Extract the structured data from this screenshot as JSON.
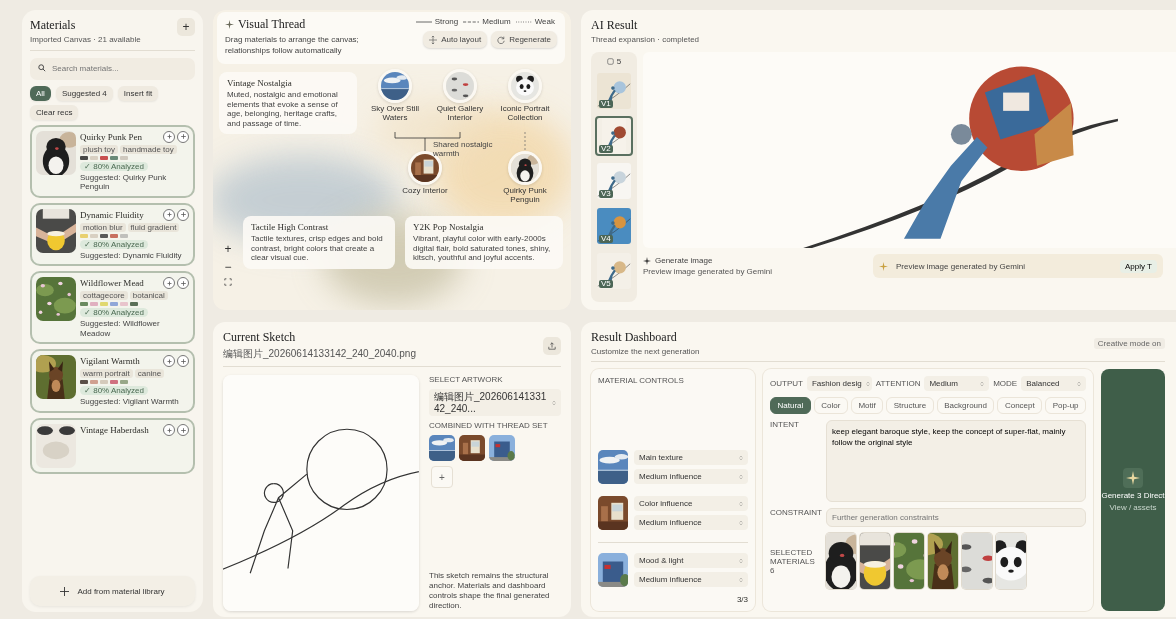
{
  "sidebar": {
    "title": "Materials",
    "subtitle": "Imported Canvas · 21 available",
    "add": "+",
    "search": {
      "placeholder": "Search materials..."
    },
    "filters": [
      {
        "label": "All",
        "selected": true
      },
      {
        "label": "Suggested 4",
        "selected": false
      },
      {
        "label": "Insert fit",
        "selected": false
      },
      {
        "label": "Clear recs",
        "selected": false
      }
    ],
    "materials": [
      {
        "title": "Quirky Punk Pen",
        "tags": [
          "plush toy",
          "handmade toy"
        ],
        "colors": [
          {
            "color": "#4a4a48"
          },
          {
            "color": "#d8d0c2"
          },
          {
            "color": "#c85050"
          },
          {
            "color": "#6a8a78"
          },
          {
            "color": "#cfc9be"
          }
        ],
        "badge": "✓ 80% Analyzed",
        "description": "Suggested: Quirky Punk Penguin"
      },
      {
        "title": "Dynamic Fluidity",
        "tags": [
          "motion blur",
          "fluid gradient"
        ],
        "colors": [
          {
            "color": "#e8d070"
          },
          {
            "color": "#d8d0c2"
          },
          {
            "color": "#5a5a58"
          },
          {
            "color": "#c87060"
          },
          {
            "color": "#c0c0bc"
          }
        ],
        "badge": "✓ 80% Analyzed",
        "description": "Suggested: Dynamic Fluidity"
      },
      {
        "title": "Wildflower Mead",
        "tags": [
          "cottagecore",
          "botanical"
        ],
        "colors": [
          {
            "color": "#6a8a60"
          },
          {
            "color": "#e0b0c0"
          },
          {
            "color": "#e0d870"
          },
          {
            "color": "#90a8d8"
          },
          {
            "color": "#e8c4cc"
          },
          {
            "color": "#5a7058"
          }
        ],
        "badge": "✓ 80% Analyzed",
        "description": "Suggested: Wildflower Meadow"
      },
      {
        "title": "Vigilant Warmth",
        "tags": [
          "warm portrait",
          "canine"
        ],
        "colors": [
          {
            "color": "#5a5048"
          },
          {
            "color": "#d0a090"
          },
          {
            "color": "#d4cabb"
          },
          {
            "color": "#d07080"
          },
          {
            "color": "#98a888"
          }
        ],
        "badge": "✓ 80% Analyzed",
        "description": "Suggested: Vigilant Warmth"
      },
      {
        "title": "Vintage Haberdash"
      }
    ],
    "add_button": "Add from material library"
  },
  "visual_thread": {
    "title": "Visual Thread",
    "description": "Drag materials to arrange the canvas; relationships follow automatically",
    "legend": [
      {
        "label": "Strong",
        "kind": "solid"
      },
      {
        "label": "Medium",
        "kind": "dashed"
      },
      {
        "label": "Weak",
        "kind": "dotted"
      }
    ],
    "buttons": [
      "Auto layout",
      "Regenerate"
    ],
    "nodes": [
      {
        "label": "Sky Over Still Waters",
        "kind": "picture"
      },
      {
        "label": "Quiet Gallery Interior",
        "kind": "picture"
      },
      {
        "label": "Iconic Portrait Collection",
        "kind": "picture"
      },
      {
        "label": "Cozy Interior",
        "kind": "picture"
      },
      {
        "label": "Quirky Punk Penguin",
        "kind": "picture"
      }
    ],
    "link_label": "Shared nostalgic warmth",
    "themes": [
      {
        "title": "Vintage Nostalgia",
        "description": "Muted, nostalgic and emotional elements that evoke a sense of age, belonging, heritage crafts, and passage of time."
      },
      {
        "title": "Tactile High Contrast",
        "description": "Tactile textures, crisp edges and bold contrast, bright colors that create a clear visual cue."
      },
      {
        "title": "Y2K Pop Nostalgia",
        "description": "Vibrant, playful color with early-2000s digital flair, bold saturated tones, shiny, kitsch, youthful and joyful accents."
      }
    ],
    "zoom": [
      "+",
      "−"
    ]
  },
  "ai_result": {
    "title": "AI Result",
    "subtitle": "Thread expansion · completed",
    "history_count": "5",
    "history": [
      {
        "label": "V1",
        "selected": false
      },
      {
        "label": "V2",
        "selected": true
      },
      {
        "label": "V3",
        "selected": false
      },
      {
        "label": "V4",
        "selected": false
      },
      {
        "label": "V5",
        "selected": false
      }
    ],
    "caption_title": "Generate image",
    "caption": "Preview image generated by Gemini",
    "notice": "Preview image generated by Gemini",
    "apply": "Apply T"
  },
  "sketch": {
    "title": "Current Sketch",
    "filename": "编辑图片_20260614133142_240_2040.png",
    "select_label": "SELECT ARTWORK",
    "select_value": "编辑图片_20260614133142_240...",
    "combined_label": "COMBINED WITH THREAD SET",
    "add": "+",
    "note": "This sketch remains the structural anchor. Materials and dashboard controls shape the final generated direction."
  },
  "dashboard": {
    "title": "Result Dashboard",
    "subtitle": "Customize the next generation",
    "chip": "Creative mode on",
    "controls_label": "MATERIAL CONTROLS",
    "controls": [
      {
        "primary": "Main texture",
        "influence": "Medium influence"
      },
      {
        "primary": "Color influence",
        "influence": "Medium influence"
      },
      {
        "primary": "Mood & light",
        "influence": "Medium influence"
      }
    ],
    "count": "3/3",
    "settings": [
      {
        "label": "OUTPUT",
        "value": "Fashion desig"
      },
      {
        "label": "ATTENTION",
        "value": "Medium"
      },
      {
        "label": "MODE",
        "value": "Balanced"
      }
    ],
    "tabs": [
      {
        "label": "Natural",
        "selected": true
      },
      {
        "label": "Color",
        "selected": false
      },
      {
        "label": "Motif",
        "selected": false
      },
      {
        "label": "Structure",
        "selected": false
      },
      {
        "label": "Background",
        "selected": false
      },
      {
        "label": "Concept",
        "selected": false
      },
      {
        "label": "Pop-up",
        "selected": false
      }
    ],
    "intent_label": "INTENT",
    "intent": "keep elegant baroque style, keep the concept of super-flat, mainly follow the original style",
    "constraint_label": "CONSTRAINT",
    "constraint_placeholder": "Further generation constraints",
    "materials_label": "SELECTED MATERIALS 6",
    "generate": {
      "title": "Generate 3 Direct",
      "subtitle": "View / assets"
    }
  }
}
